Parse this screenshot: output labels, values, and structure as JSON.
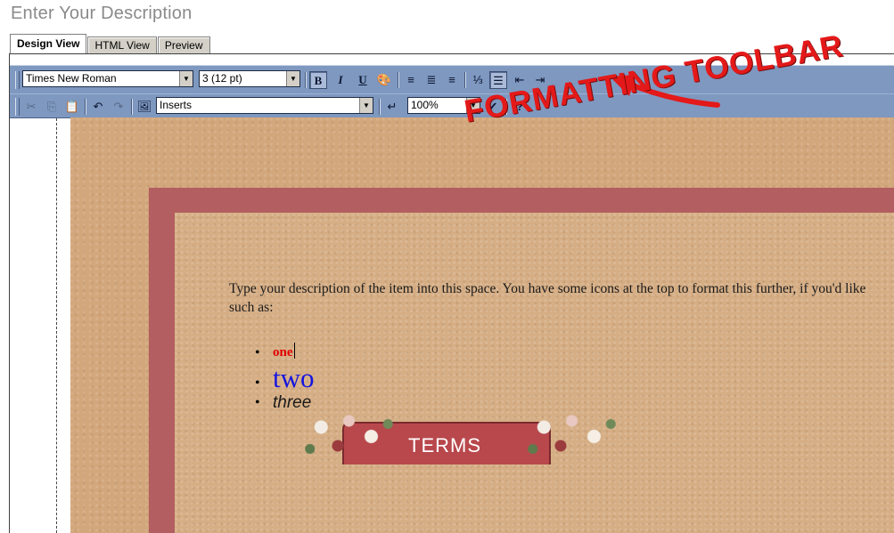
{
  "page": {
    "title": "Enter Your Description"
  },
  "tabs": [
    {
      "label": "Design View",
      "active": true
    },
    {
      "label": "HTML View",
      "active": false
    },
    {
      "label": "Preview",
      "active": false
    }
  ],
  "toolbar": {
    "font_family": "Times New Roman",
    "font_size": "3 (12 pt)",
    "bold_label": "B",
    "italic_label": "I",
    "underline_label": "U",
    "inserts": "Inserts",
    "zoom": "100%",
    "help_label": "?",
    "icons": [
      "bold-icon",
      "italic-icon",
      "underline-icon",
      "text-color-icon",
      "align-left-icon",
      "align-center-icon",
      "align-right-icon",
      "numbered-list-icon",
      "bullet-list-icon",
      "outdent-icon",
      "indent-icon",
      "cut-icon",
      "copy-icon",
      "paste-icon",
      "undo-icon",
      "redo-icon",
      "image-icon",
      "line-break-icon",
      "spell-check-icon",
      "help-icon"
    ]
  },
  "content": {
    "description": "Type your description of the item into this space. You have some icons at the top to format this further, if you'd like such as:",
    "list_items": [
      "one",
      "two",
      "three"
    ],
    "banner_text": "TERMS"
  },
  "annotation": {
    "text": "FORMATTING TOOLBAR",
    "color": "#e41919"
  },
  "colors": {
    "toolbar_bg": "#7e98c0",
    "frame": "#b35e60",
    "parchment": "#d3a77c",
    "item_one": "#e00000",
    "item_two": "#1414e0"
  }
}
